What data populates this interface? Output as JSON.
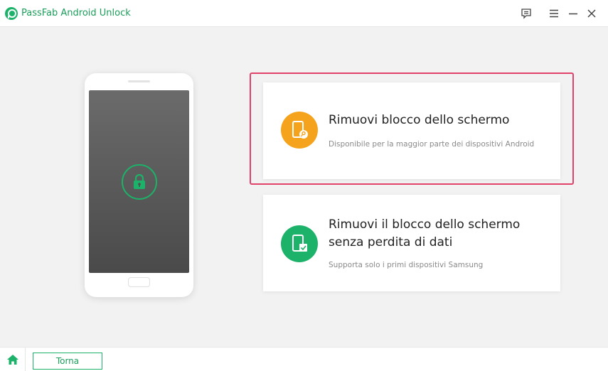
{
  "window": {
    "title": "PassFab Android Unlock",
    "logo_icon": "passfab-logo-icon",
    "controls": [
      "feedback-icon",
      "menu-icon",
      "minimize-icon",
      "close-icon"
    ]
  },
  "illustration": {
    "lock_icon": "padlock-icon"
  },
  "options": [
    {
      "title": "Rimuovi blocco dello schermo",
      "description": "Disponibile per la maggior parte dei dispositivi Android",
      "icon": "phone-key-icon",
      "icon_color": "#f5a31c",
      "selected": true
    },
    {
      "title": "Rimuovi il blocco dello schermo senza perdita di dati",
      "description": "Supporta solo i primi dispositivi Samsung",
      "icon": "phone-check-icon",
      "icon_color": "#1db269",
      "selected": false
    }
  ],
  "footer": {
    "home_icon": "home-icon",
    "back_label": "Torna"
  },
  "colors": {
    "accent": "#1db269",
    "selection": "#e0426a",
    "warning": "#f5a31c"
  }
}
